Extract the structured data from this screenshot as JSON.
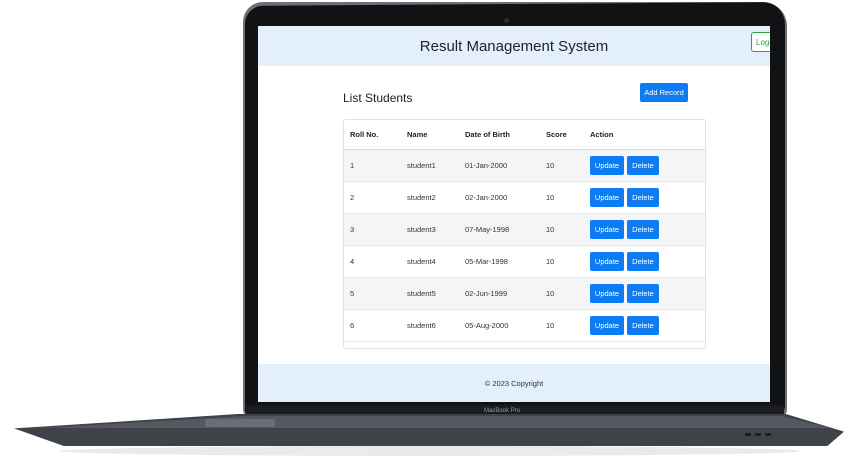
{
  "app": {
    "title": "Result Management System",
    "logout_label": "Logo"
  },
  "page": {
    "heading": "List Students",
    "add_button": "Add Record"
  },
  "table": {
    "columns": [
      "Roll No.",
      "Name",
      "Date of Birth",
      "Score",
      "Action"
    ],
    "rows": [
      {
        "roll": "1",
        "name": "student1",
        "dob": "01-Jan-2000",
        "score": "10"
      },
      {
        "roll": "2",
        "name": "student2",
        "dob": "02-Jan-2000",
        "score": "10"
      },
      {
        "roll": "3",
        "name": "student3",
        "dob": "07-May-1998",
        "score": "10"
      },
      {
        "roll": "4",
        "name": "student4",
        "dob": "05-Mar-1998",
        "score": "10"
      },
      {
        "roll": "5",
        "name": "student5",
        "dob": "02-Jun-1999",
        "score": "10"
      },
      {
        "roll": "6",
        "name": "student6",
        "dob": "05-Aug-2000",
        "score": "10"
      }
    ],
    "update_label": "Update",
    "delete_label": "Delete"
  },
  "footer": {
    "text": "© 2023 Copyright"
  },
  "device": {
    "brand": "MacBook Pro"
  },
  "colors": {
    "primary": "#0d7cf2",
    "header_bg": "#e3f0fb",
    "logout_border": "#28a745"
  }
}
